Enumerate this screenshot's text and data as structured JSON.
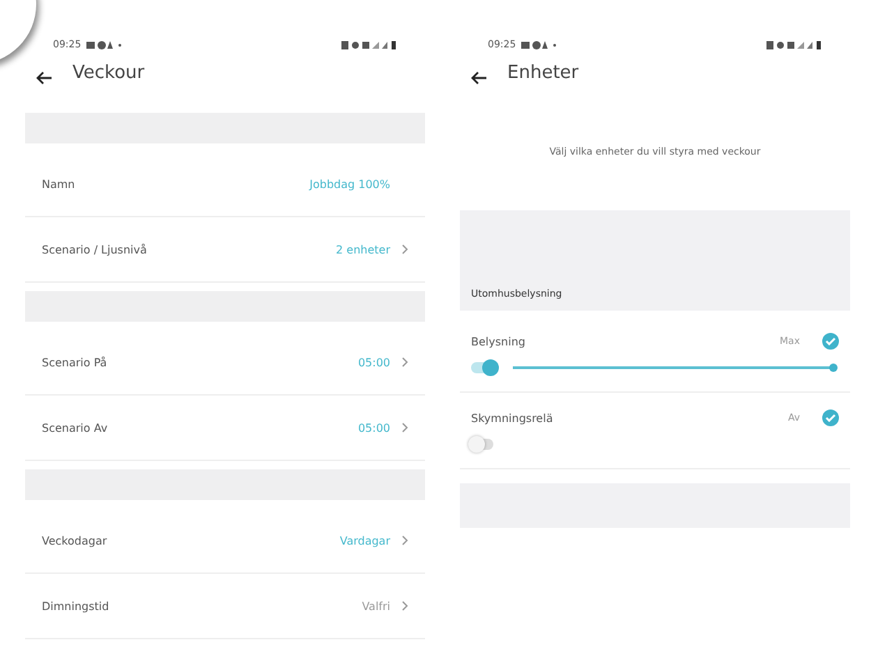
{
  "screens": [
    {
      "status_time": "09:25",
      "title": "Veckour",
      "groups": [
        [
          {
            "label": "Namn",
            "value": "Jobbdag 100%",
            "dimmed": false,
            "chevron": false
          },
          {
            "label": "Scenario / Ljusnivå",
            "value": "2 enheter",
            "dimmed": false,
            "chevron": true
          }
        ],
        [
          {
            "label": "Scenario På",
            "value": "05:00",
            "dimmed": false,
            "chevron": true
          },
          {
            "label": "Scenario Av",
            "value": "05:00",
            "dimmed": false,
            "chevron": true
          }
        ],
        [
          {
            "label": "Veckodagar",
            "value": "Vardagar",
            "dimmed": false,
            "chevron": true
          },
          {
            "label": "Dimningstid",
            "value": "Valfri",
            "dimmed": true,
            "chevron": true
          }
        ]
      ]
    },
    {
      "status_time": "09:25",
      "title": "Enheter",
      "intro": "Välj vilka enheter du vill styra med veckour",
      "section": "Utomhusbelysning",
      "devices": [
        {
          "name": "Belysning",
          "value": "Max",
          "checked": true,
          "kind": "slider",
          "on": true,
          "level": 1
        },
        {
          "name": "Skymningsrelä",
          "value": "Av",
          "checked": true,
          "kind": "switch",
          "on": false
        }
      ]
    }
  ]
}
